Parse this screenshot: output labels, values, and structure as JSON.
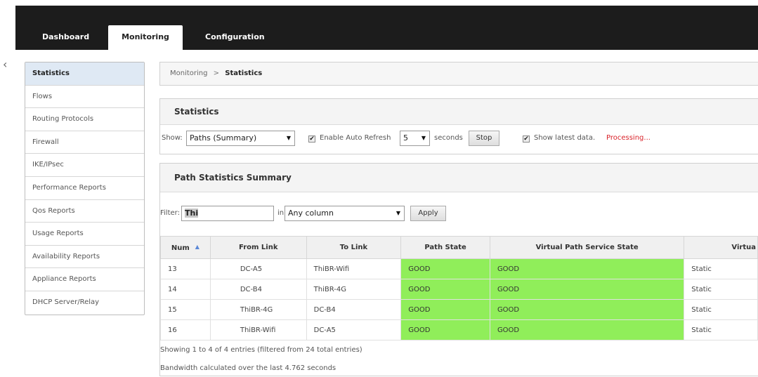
{
  "nav": {
    "tabs": [
      {
        "label": "Dashboard"
      },
      {
        "label": "Monitoring"
      },
      {
        "label": "Configuration"
      }
    ],
    "active_tab": "Monitoring"
  },
  "sidebar": {
    "items": [
      {
        "label": "Statistics",
        "active": true
      },
      {
        "label": "Flows"
      },
      {
        "label": "Routing Protocols"
      },
      {
        "label": "Firewall"
      },
      {
        "label": "IKE/IPsec"
      },
      {
        "label": "Performance Reports"
      },
      {
        "label": "Qos Reports"
      },
      {
        "label": "Usage Reports"
      },
      {
        "label": "Availability Reports"
      },
      {
        "label": "Appliance Reports"
      },
      {
        "label": "DHCP Server/Relay"
      }
    ]
  },
  "breadcrumb": {
    "parent": "Monitoring",
    "separator": ">",
    "current": "Statistics"
  },
  "statistics_panel": {
    "title": "Statistics",
    "show_label": "Show:",
    "show_value": "Paths (Summary)",
    "auto_refresh_label": "Enable Auto Refresh",
    "auto_refresh_checked": true,
    "refresh_interval": "5",
    "seconds_label": "seconds",
    "stop_label": "Stop",
    "latest_label": "Show latest data.",
    "latest_checked": true,
    "status_text": "Processing..."
  },
  "path_summary": {
    "title": "Path Statistics Summary",
    "filter_label": "Filter:",
    "filter_value": "Thi",
    "in_label": "in",
    "column_select": "Any column",
    "apply_label": "Apply",
    "columns": [
      "Num",
      "From Link",
      "To Link",
      "Path State",
      "Virtual Path Service State",
      "Virtua"
    ],
    "rows": [
      [
        "13",
        "DC-A5",
        "ThiBR-Wifi",
        "GOOD",
        "GOOD",
        "Static"
      ],
      [
        "14",
        "DC-B4",
        "ThiBR-4G",
        "GOOD",
        "GOOD",
        "Static"
      ],
      [
        "15",
        "ThiBR-4G",
        "DC-B4",
        "GOOD",
        "GOOD",
        "Static"
      ],
      [
        "16",
        "ThiBR-Wifi",
        "DC-A5",
        "GOOD",
        "GOOD",
        "Static"
      ]
    ],
    "footer_entries": "Showing 1 to 4 of 4 entries (filtered from 24 total entries)",
    "footer_bandwidth": "Bandwidth calculated over the last 4.762 seconds"
  },
  "colors": {
    "top_bar": "#1c1c1c",
    "good_state": "#90ee5a",
    "processing": "#d9232a",
    "sidebar_active": "#dfe9f4"
  },
  "icons": {
    "collapse": "chevron-left-icon",
    "sort": "sort-ascending-icon",
    "dropdown": "caret-down-icon",
    "checkbox": "checkbox-checked-icon"
  }
}
